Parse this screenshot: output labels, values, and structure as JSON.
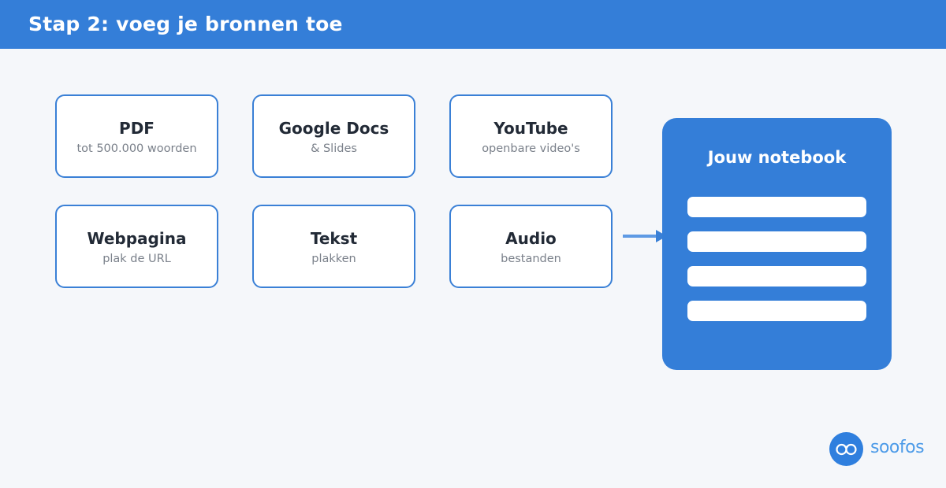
{
  "header": {
    "title": "Stap 2: voeg je bronnen toe"
  },
  "sources": [
    {
      "title": "PDF",
      "subtitle": "tot 500.000 woorden"
    },
    {
      "title": "Google Docs",
      "subtitle": "& Slides"
    },
    {
      "title": "YouTube",
      "subtitle": "openbare video's"
    },
    {
      "title": "Webpagina",
      "subtitle": "plak de URL"
    },
    {
      "title": "Tekst",
      "subtitle": "plakken"
    },
    {
      "title": "Audio",
      "subtitle": "bestanden"
    }
  ],
  "notebook": {
    "title": "Jouw notebook"
  },
  "logo": {
    "text": "soofos",
    "icon": "glasses-icon"
  },
  "colors": {
    "header": "#347ed8",
    "card_border": "#3a80d6",
    "notebook": "#347ed8",
    "arrow": "#5e9ae4",
    "background": "#f5f7fa"
  }
}
